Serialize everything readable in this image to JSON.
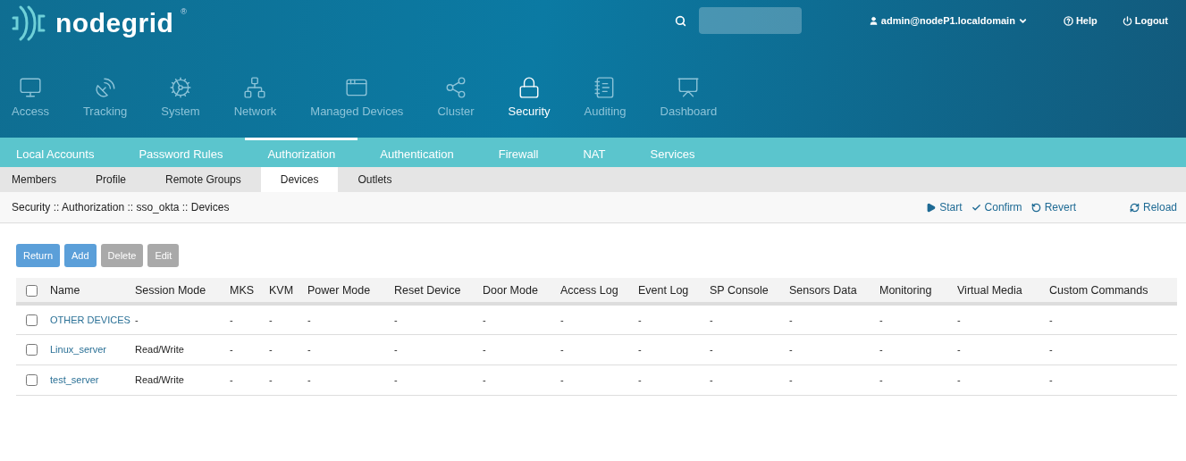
{
  "header": {
    "logo": "nodegrid",
    "registered": "®",
    "user": "admin@nodeP1.localdomain",
    "help": "Help",
    "logout": "Logout"
  },
  "nav": [
    {
      "label": "Access",
      "selected": false
    },
    {
      "label": "Tracking",
      "selected": false
    },
    {
      "label": "System",
      "selected": false
    },
    {
      "label": "Network",
      "selected": false
    },
    {
      "label": "Managed Devices",
      "selected": false
    },
    {
      "label": "Cluster",
      "selected": false
    },
    {
      "label": "Security",
      "selected": true
    },
    {
      "label": "Auditing",
      "selected": false
    },
    {
      "label": "Dashboard",
      "selected": false
    }
  ],
  "tabs": [
    {
      "label": "Local Accounts",
      "selected": false
    },
    {
      "label": "Password Rules",
      "selected": false
    },
    {
      "label": "Authorization",
      "selected": true
    },
    {
      "label": "Authentication",
      "selected": false
    },
    {
      "label": "Firewall",
      "selected": false
    },
    {
      "label": "NAT",
      "selected": false
    },
    {
      "label": "Services",
      "selected": false
    }
  ],
  "subtabs": [
    {
      "label": "Members",
      "selected": false
    },
    {
      "label": "Profile",
      "selected": false
    },
    {
      "label": "Remote Groups",
      "selected": false
    },
    {
      "label": "Devices",
      "selected": true
    },
    {
      "label": "Outlets",
      "selected": false
    }
  ],
  "breadcrumb": "Security :: Authorization :: sso_okta :: Devices",
  "actions": [
    {
      "label": "Start",
      "kind": "start"
    },
    {
      "label": "Confirm",
      "kind": "confirm"
    },
    {
      "label": "Revert",
      "kind": "revert"
    },
    {
      "label": "Reload",
      "kind": "reload"
    }
  ],
  "buttons": [
    {
      "label": "Return",
      "disabled": false
    },
    {
      "label": "Add",
      "disabled": false
    },
    {
      "label": "Delete",
      "disabled": true
    },
    {
      "label": "Edit",
      "disabled": true
    }
  ],
  "table": {
    "all_checked": false,
    "columns": [
      "Name",
      "Session Mode",
      "MKS",
      "KVM",
      "Power Mode",
      "Reset Device",
      "Door Mode",
      "Access Log",
      "Event Log",
      "SP Console",
      "Sensors Data",
      "Monitoring",
      "Virtual Media",
      "Custom Commands"
    ],
    "rows": [
      {
        "checked": false,
        "cells": [
          "OTHER DEVICES",
          "-",
          "-",
          "-",
          "-",
          "-",
          "-",
          "-",
          "-",
          "-",
          "-",
          "-",
          "-",
          "-"
        ]
      },
      {
        "checked": false,
        "cells": [
          "Linux_server",
          "Read/Write",
          "-",
          "-",
          "-",
          "-",
          "-",
          "-",
          "-",
          "-",
          "-",
          "-",
          "-",
          "-"
        ]
      },
      {
        "checked": false,
        "cells": [
          "test_server",
          "Read/Write",
          "-",
          "-",
          "-",
          "-",
          "-",
          "-",
          "-",
          "-",
          "-",
          "-",
          "-",
          "-"
        ]
      }
    ]
  }
}
